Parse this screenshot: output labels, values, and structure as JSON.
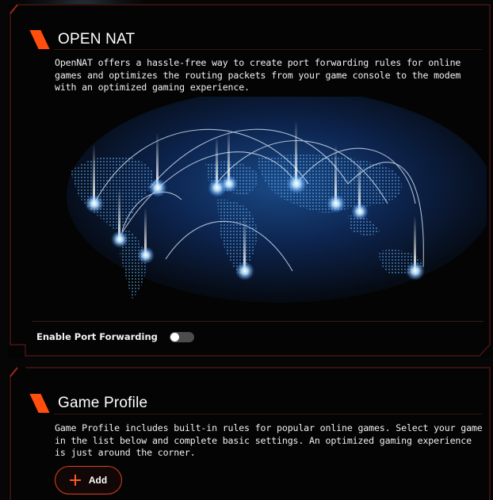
{
  "colors": {
    "accent": "#ff4e0e",
    "frame": "#4a1414",
    "background": "#060606"
  },
  "open_nat": {
    "title": "OPEN NAT",
    "description": "OpenNAT offers a hassle-free way to create port forwarding rules for online games and optimizes the routing packets from your game console to the modem with an optimized gaming experience.",
    "map_image": "world-network-map",
    "toggle": {
      "label": "Enable Port Forwarding",
      "state": "off"
    }
  },
  "game_profile": {
    "title": "Game Profile",
    "description": "Game Profile includes built-in rules for popular online games. Select your game in the list below and complete basic settings. An optimized gaming experience is just around the corner.",
    "add_button": {
      "label": "Add",
      "icon": "plus-icon"
    }
  }
}
